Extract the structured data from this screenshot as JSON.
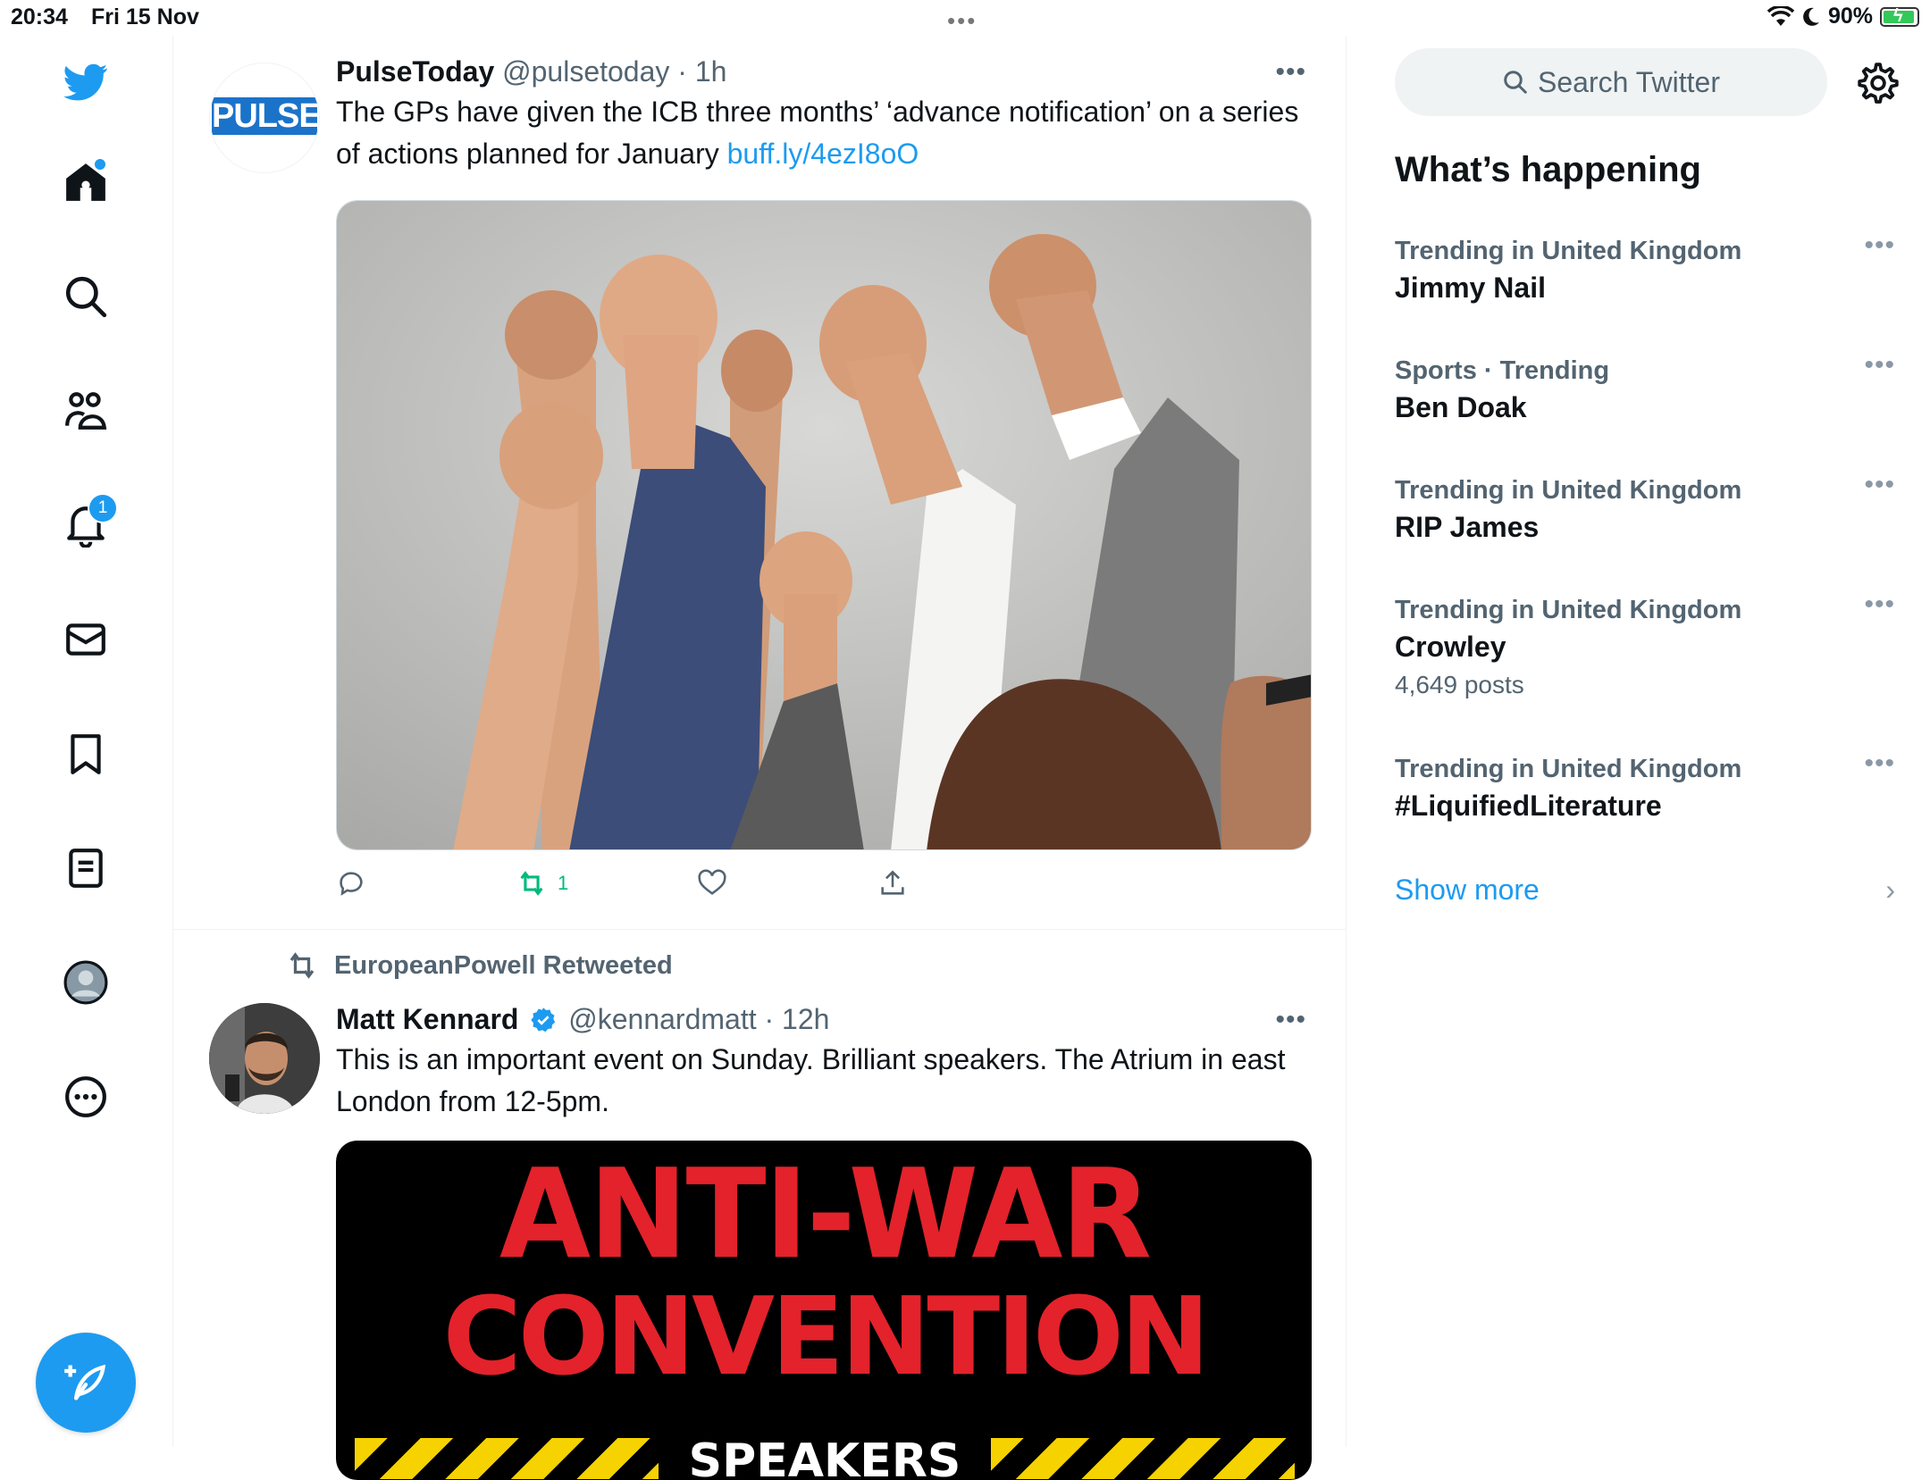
{
  "status_bar": {
    "time": "20:34",
    "date": "Fri 15 Nov",
    "battery": "90%"
  },
  "nav": {
    "notification_count": "1"
  },
  "tweets": [
    {
      "name": "PulseToday",
      "handle": "@pulsetoday",
      "time": "1h",
      "avatar_text": "PULSE",
      "text": "The GPs have given the ICB three months’ ‘advance notification’ on a series of actions planned for January ",
      "link": "buff.ly/4ezI8oO",
      "retweet_count": "1"
    },
    {
      "retweeted_by": "EuropeanPowell Retweeted",
      "name": "Matt Kennard",
      "handle": "@kennardmatt",
      "time": "12h",
      "text": "This is an important event on Sunday. Brilliant speakers. The Atrium in east London from 12-5pm.",
      "poster_line1": "ANTI-WAR",
      "poster_line2": "CONVENTION",
      "poster_line3": "SPEAKERS"
    }
  ],
  "sidebar": {
    "search_placeholder": "Search Twitter",
    "title": "What’s happening",
    "trends": [
      {
        "meta": "Trending in United Kingdom",
        "name": "Jimmy Nail",
        "count": ""
      },
      {
        "meta": "Sports · Trending",
        "name": "Ben Doak",
        "count": ""
      },
      {
        "meta": "Trending in United Kingdom",
        "name": "RIP James",
        "count": ""
      },
      {
        "meta": "Trending in United Kingdom",
        "name": "Crowley",
        "count": "4,649 posts"
      },
      {
        "meta": "Trending in United Kingdom",
        "name": "#LiquifiedLiterature",
        "count": ""
      }
    ],
    "show_more": "Show more"
  },
  "colors": {
    "accent": "#1d9bf0",
    "retweet": "#00ba7c",
    "poster_red": "#e3222b"
  },
  "icons": [
    "twitter-logo-icon",
    "home-icon",
    "search-icon",
    "communities-icon",
    "bell-icon",
    "mail-icon",
    "bookmark-icon",
    "lists-icon",
    "profile-icon",
    "more-icon",
    "compose-icon",
    "reply-icon",
    "retweet-icon",
    "like-icon",
    "share-icon",
    "gear-icon",
    "verified-icon",
    "chevron-right-icon"
  ]
}
